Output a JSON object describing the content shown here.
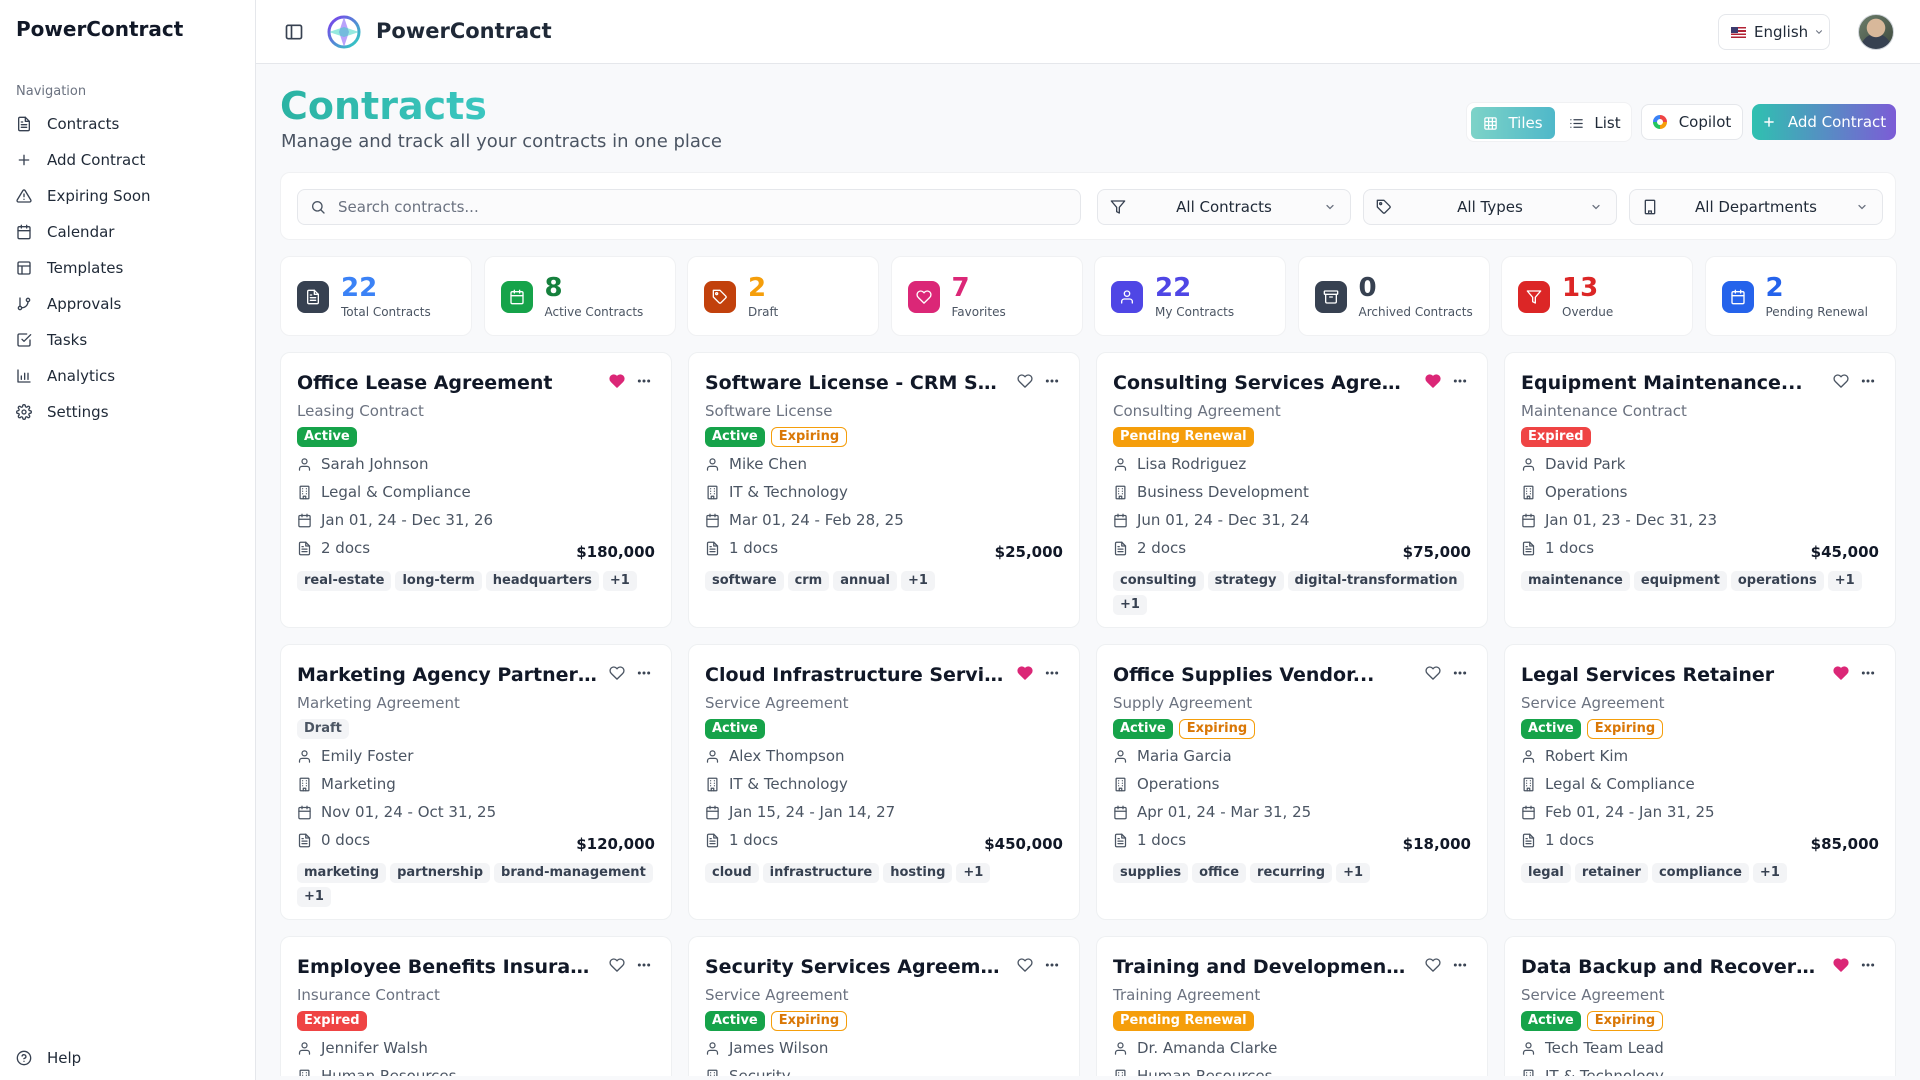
{
  "app": {
    "name": "PowerContract",
    "language": "English"
  },
  "sidebar": {
    "section": "Navigation",
    "items": [
      {
        "label": "Contracts",
        "icon": "file-text-icon"
      },
      {
        "label": "Add Contract",
        "icon": "plus-icon"
      },
      {
        "label": "Expiring Soon",
        "icon": "alert-triangle-icon"
      },
      {
        "label": "Calendar",
        "icon": "calendar-icon"
      },
      {
        "label": "Templates",
        "icon": "layout-template-icon"
      },
      {
        "label": "Approvals",
        "icon": "git-branch-icon"
      },
      {
        "label": "Tasks",
        "icon": "check-square-icon"
      },
      {
        "label": "Analytics",
        "icon": "bar-chart-icon"
      },
      {
        "label": "Settings",
        "icon": "gear-icon"
      }
    ],
    "help": "Help"
  },
  "page": {
    "title": "Contracts",
    "subtitle": "Manage and track all your contracts in one place"
  },
  "toolbar": {
    "tiles": "Tiles",
    "list": "List",
    "copilot": "Copilot",
    "add_contract": "Add Contract",
    "active_view": "Tiles"
  },
  "filters": {
    "search_placeholder": "Search contracts...",
    "search_value": "",
    "status": "All Contracts",
    "type": "All Types",
    "department": "All Departments"
  },
  "stats": [
    {
      "value": "22",
      "label": "Total Contracts",
      "color": "#3b82f6",
      "bg": "#374151",
      "icon": "file-text-icon"
    },
    {
      "value": "8",
      "label": "Active Contracts",
      "color": "#15803d",
      "bg": "#16a34a",
      "icon": "calendar-icon"
    },
    {
      "value": "2",
      "label": "Draft",
      "color": "#f59e0b",
      "bg": "#c2410c",
      "icon": "tag-icon"
    },
    {
      "value": "7",
      "label": "Favorites",
      "color": "#db2777",
      "bg": "#db2777",
      "icon": "heart-icon"
    },
    {
      "value": "22",
      "label": "My Contracts",
      "color": "#4f46e5",
      "bg": "#4f46e5",
      "icon": "user-icon"
    },
    {
      "value": "0",
      "label": "Archived Contracts",
      "color": "#374151",
      "bg": "#374151",
      "icon": "archive-icon"
    },
    {
      "value": "13",
      "label": "Overdue",
      "color": "#dc2626",
      "bg": "#dc2626",
      "icon": "filter-icon"
    },
    {
      "value": "2",
      "label": "Pending Renewal",
      "color": "#2563eb",
      "bg": "#2563eb",
      "icon": "calendar-icon"
    }
  ],
  "contracts": [
    {
      "title": "Office Lease Agreement",
      "type": "Leasing Contract",
      "favorite": true,
      "badges": [
        "Active"
      ],
      "owner": "Sarah Johnson",
      "department": "Legal & Compliance",
      "dates": "Jan 01, 24 - Dec 31, 26",
      "docs": "2 docs",
      "amount": "$180,000",
      "tags": [
        "real-estate",
        "long-term",
        "headquarters",
        "+1"
      ]
    },
    {
      "title": "Software License - CRM System",
      "type": "Software License",
      "favorite": false,
      "badges": [
        "Active",
        "Expiring"
      ],
      "owner": "Mike Chen",
      "department": "IT & Technology",
      "dates": "Mar 01, 24 - Feb 28, 25",
      "docs": "1 docs",
      "amount": "$25,000",
      "tags": [
        "software",
        "crm",
        "annual",
        "+1"
      ]
    },
    {
      "title": "Consulting Services Agreement",
      "type": "Consulting Agreement",
      "favorite": true,
      "badges": [
        "Pending Renewal"
      ],
      "owner": "Lisa Rodriguez",
      "department": "Business Development",
      "dates": "Jun 01, 24 - Dec 31, 24",
      "docs": "2 docs",
      "amount": "$75,000",
      "tags": [
        "consulting",
        "strategy",
        "digital-transformation",
        "+1"
      ]
    },
    {
      "title": "Equipment Maintenance...",
      "type": "Maintenance Contract",
      "favorite": false,
      "badges": [
        "Expired"
      ],
      "owner": "David Park",
      "department": "Operations",
      "dates": "Jan 01, 23 - Dec 31, 23",
      "docs": "1 docs",
      "amount": "$45,000",
      "tags": [
        "maintenance",
        "equipment",
        "operations",
        "+1"
      ]
    },
    {
      "title": "Marketing Agency Partnership",
      "type": "Marketing Agreement",
      "favorite": false,
      "badges": [
        "Draft"
      ],
      "owner": "Emily Foster",
      "department": "Marketing",
      "dates": "Nov 01, 24 - Oct 31, 25",
      "docs": "0 docs",
      "amount": "$120,000",
      "tags": [
        "marketing",
        "partnership",
        "brand-management",
        "+1"
      ]
    },
    {
      "title": "Cloud Infrastructure Services",
      "type": "Service Agreement",
      "favorite": true,
      "badges": [
        "Active"
      ],
      "owner": "Alex Thompson",
      "department": "IT & Technology",
      "dates": "Jan 15, 24 - Jan 14, 27",
      "docs": "1 docs",
      "amount": "$450,000",
      "tags": [
        "cloud",
        "infrastructure",
        "hosting",
        "+1"
      ]
    },
    {
      "title": "Office Supplies Vendor...",
      "type": "Supply Agreement",
      "favorite": false,
      "badges": [
        "Active",
        "Expiring"
      ],
      "owner": "Maria Garcia",
      "department": "Operations",
      "dates": "Apr 01, 24 - Mar 31, 25",
      "docs": "1 docs",
      "amount": "$18,000",
      "tags": [
        "supplies",
        "office",
        "recurring",
        "+1"
      ]
    },
    {
      "title": "Legal Services Retainer",
      "type": "Service Agreement",
      "favorite": true,
      "badges": [
        "Active",
        "Expiring"
      ],
      "owner": "Robert Kim",
      "department": "Legal & Compliance",
      "dates": "Feb 01, 24 - Jan 31, 25",
      "docs": "1 docs",
      "amount": "$85,000",
      "tags": [
        "legal",
        "retainer",
        "compliance",
        "+1"
      ]
    },
    {
      "title": "Employee Benefits Insurance",
      "type": "Insurance Contract",
      "favorite": false,
      "badges": [
        "Expired"
      ],
      "owner": "Jennifer Walsh",
      "department": "Human Resources",
      "dates": "",
      "docs": "",
      "amount": "",
      "tags": []
    },
    {
      "title": "Security Services Agreement",
      "type": "Service Agreement",
      "favorite": false,
      "badges": [
        "Active",
        "Expiring"
      ],
      "owner": "James Wilson",
      "department": "Security",
      "dates": "",
      "docs": "",
      "amount": "",
      "tags": []
    },
    {
      "title": "Training and Development...",
      "type": "Training Agreement",
      "favorite": false,
      "badges": [
        "Pending Renewal"
      ],
      "owner": "Dr. Amanda Clarke",
      "department": "Human Resources",
      "dates": "",
      "docs": "",
      "amount": "",
      "tags": []
    },
    {
      "title": "Data Backup and Recovery...",
      "type": "Service Agreement",
      "favorite": true,
      "badges": [
        "Active",
        "Expiring"
      ],
      "owner": "Tech Team Lead",
      "department": "IT & Technology",
      "dates": "",
      "docs": "",
      "amount": "",
      "tags": []
    }
  ]
}
